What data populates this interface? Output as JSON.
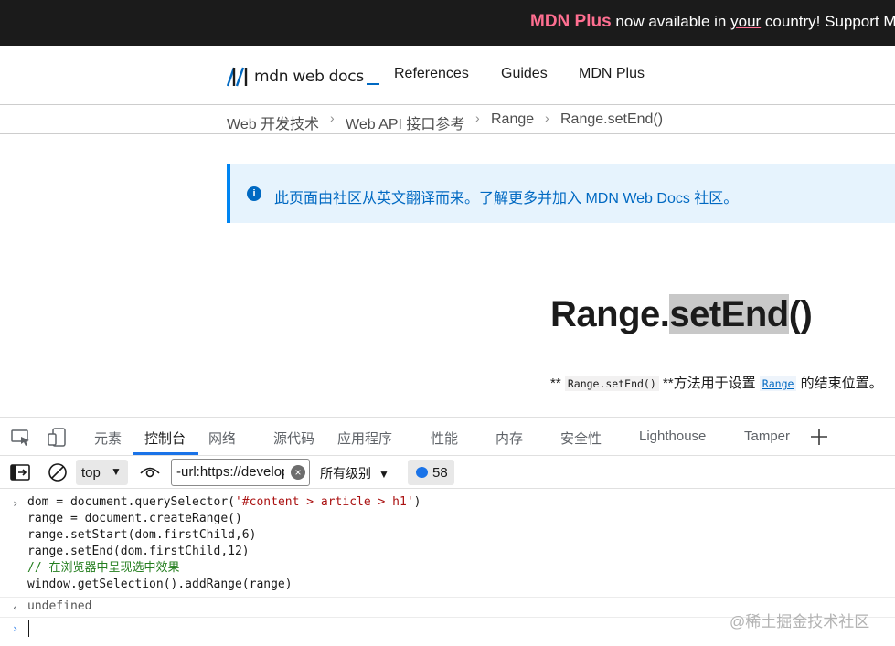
{
  "banner": {
    "plus": "MDN Plus",
    "text_a": " now available in ",
    "text_u": "your",
    "text_b": " country! Support M"
  },
  "logo": {
    "text": "mdn web docs"
  },
  "nav": {
    "references": "References",
    "guides": "Guides",
    "plus": "MDN Plus"
  },
  "breadcrumb": [
    "Web 开发技术",
    "Web API 接口参考",
    "Range",
    "Range.setEnd()"
  ],
  "notice": {
    "text": "此页面由社区从英文翻译而来。了解更多并加入 MDN Web Docs 社区。"
  },
  "page": {
    "title_a": "Range.",
    "title_sel": "setEnd",
    "title_b": "()"
  },
  "description": {
    "pre": "** ",
    "code": "Range.setEnd()",
    "mid": " **方法用于设置 ",
    "link": "Range",
    "post": " 的结束位置。"
  },
  "devtools": {
    "tabs": [
      "元素",
      "控制台",
      "网络",
      "源代码",
      "应用程序",
      "性能",
      "内存",
      "安全性",
      "Lighthouse",
      "Tamper"
    ],
    "active_tab": "控制台",
    "context": "top",
    "filter_value": "-url:https://developer.mozilla.org",
    "level": "所有级别",
    "message_count": "58"
  },
  "console": {
    "line1_a": "dom = document.querySelector(",
    "line1_str": "'#content > article > h1'",
    "line1_b": ")",
    "line2": "range = document.createRange()",
    "line3": "range.setStart(dom.firstChild,6)",
    "line4": "range.setEnd(dom.firstChild,12)",
    "line5": "// 在浏览器中呈现选中效果",
    "line6": "window.getSelection().addRange(range)",
    "result": "undefined"
  },
  "watermark": "@稀土掘金技术社区",
  "colors": {
    "accent": "#1a73e8",
    "mdn_blue": "#0069c2",
    "banner_bg": "#1b1b1b",
    "plus_pink": "#ff6f91"
  }
}
